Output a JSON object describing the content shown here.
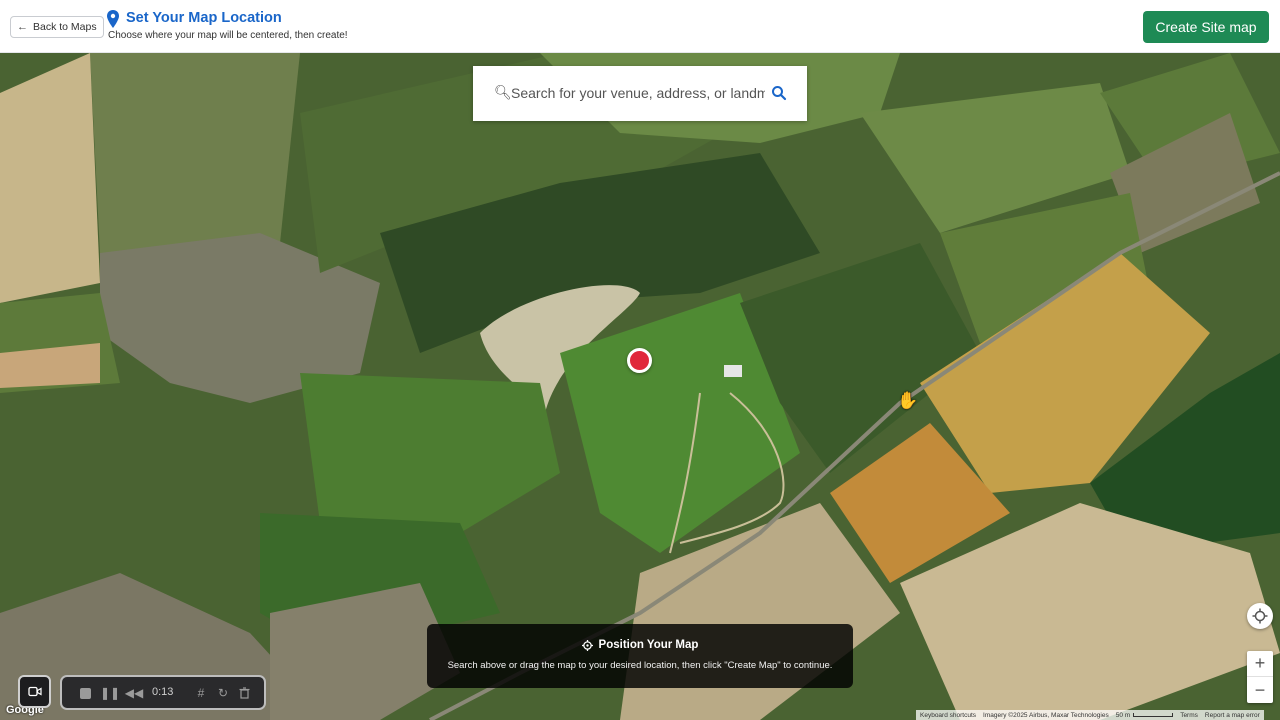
{
  "header": {
    "back_label": "Back to Maps",
    "title": "Set Your Map Location",
    "subtitle": "Choose where your map will be centered, then create!",
    "create_label": "Create Site map"
  },
  "search": {
    "placeholder": "Search for your venue, address, or landmark",
    "lead_icon": "search-icon"
  },
  "info_panel": {
    "title": "Position Your Map",
    "text": "Search above or drag the map to your desired location, then click \"Create Map\" to continue."
  },
  "map_controls": {
    "zoom_in": "+",
    "zoom_out": "−"
  },
  "attribution": {
    "keyboard": "Keyboard shortcuts",
    "imagery": "Imagery ©2025 Airbus, Maxar Technologies",
    "scale": "50 m",
    "terms": "Terms",
    "report": "Report a map error",
    "logo": "Google"
  },
  "recorder": {
    "time": "0:13"
  },
  "colors": {
    "accent_blue": "#1a66c9",
    "create_green": "#1e8a55",
    "marker_red": "#e0283a"
  }
}
